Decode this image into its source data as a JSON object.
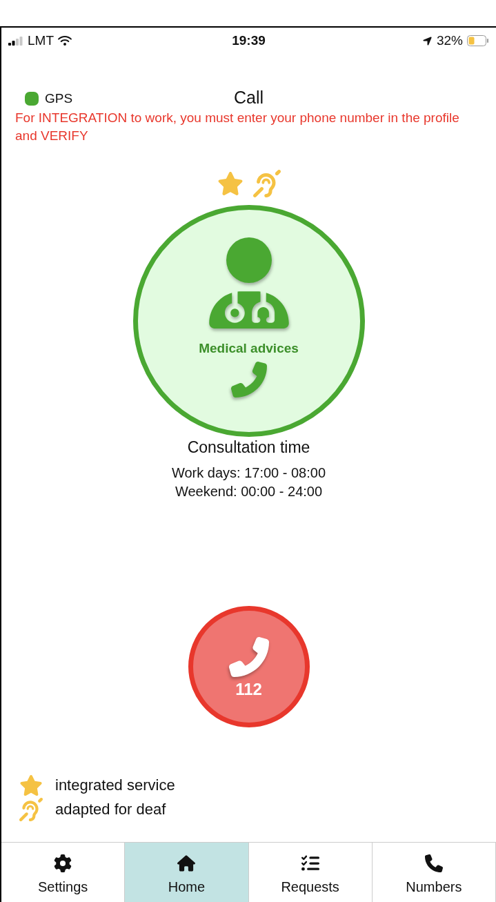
{
  "status_bar": {
    "carrier": "LMT",
    "time": "19:39",
    "battery": "32%"
  },
  "header": {
    "gps": {
      "label": "GPS",
      "color": "#4aa832"
    },
    "title": "Call",
    "warning": "For INTEGRATION to work, you must enter your phone number in the profile and VERIFY"
  },
  "service": {
    "integrated": true,
    "deaf": true,
    "name": "Medical advices",
    "hours_title": "Consultation time",
    "hours": [
      "Work days: 17:00 - 08:00",
      "Weekend: 00:00 - 24:00"
    ]
  },
  "emergency": {
    "number": "112"
  },
  "legend": [
    {
      "kind": "integrated",
      "text": "integrated service"
    },
    {
      "kind": "deaf",
      "text": "adapted for deaf"
    }
  ],
  "tabs": [
    {
      "kind": "settings",
      "label": "Settings",
      "selected": false
    },
    {
      "kind": "home",
      "label": "Home",
      "selected": true
    },
    {
      "kind": "requests",
      "label": "Requests",
      "selected": false
    },
    {
      "kind": "numbers",
      "label": "Numbers",
      "selected": false
    }
  ]
}
